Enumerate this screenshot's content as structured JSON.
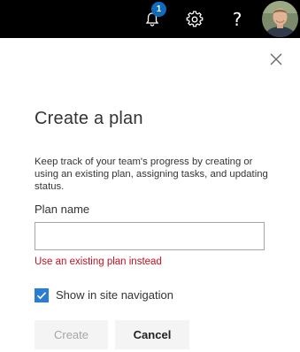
{
  "topbar": {
    "notifications_count": "1",
    "help_glyph": "?",
    "icons": [
      "bell-icon",
      "gear-icon",
      "help-icon",
      "avatar"
    ]
  },
  "panel": {
    "title": "Create a plan",
    "description": "Keep track of your team's progress by creating or using an existing plan, assigning tasks, and updating status.",
    "plan_name_label": "Plan name",
    "plan_name_value": "",
    "plan_name_placeholder": "",
    "existing_plan_link": "Use an existing plan instead",
    "show_in_nav_label": "Show in site navigation",
    "show_in_nav_checked": true,
    "create_label": "Create",
    "cancel_label": "Cancel"
  },
  "colors": {
    "topbar_bg": "#000000",
    "badge": "#0f6cbd",
    "checkbox": "#2b7cd3",
    "error_link": "#c50f1f"
  }
}
